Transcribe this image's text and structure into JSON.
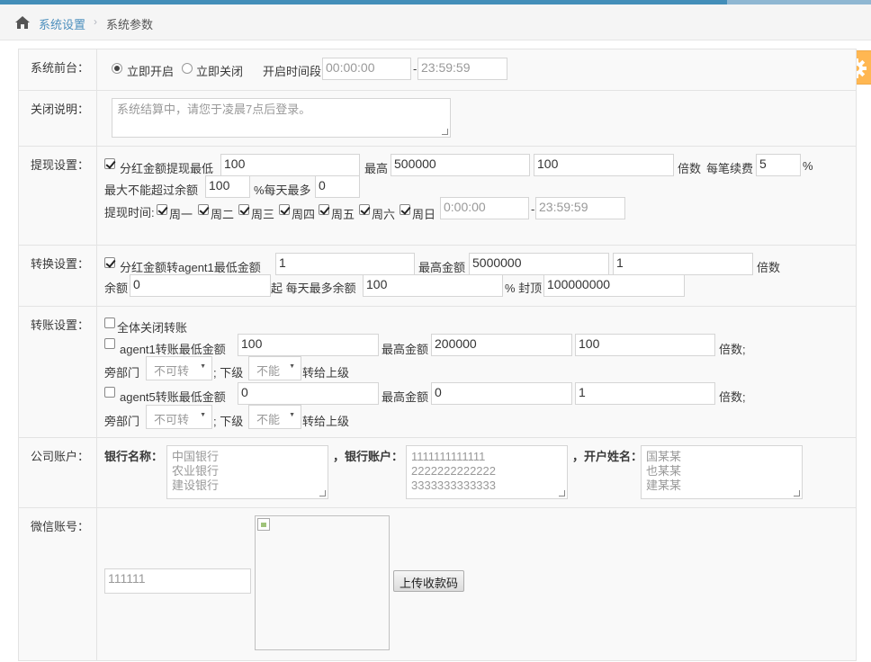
{
  "breadcrumb": {
    "home_icon": "home-icon",
    "items": [
      "系统设置",
      "系统参数"
    ]
  },
  "settings_icon": "gear-icon",
  "front": {
    "label": "系统前台：",
    "open_label": "立即开启",
    "close_label": "立即关闭",
    "open_checked": true,
    "period_label": "开启时间段",
    "start_time": "00:00:00",
    "dash": "-",
    "end_time": "23:59:59"
  },
  "close_desc": {
    "label": "关闭说明：",
    "placeholder": "系统结算中，请您于凌晨7点后登录。"
  },
  "withdraw": {
    "label": "提现设置：",
    "checkbox_label": "分红金额提现最低",
    "min": "100",
    "max_label": "最高",
    "max": "500000",
    "multiple": "100",
    "multiple_label": "倍数",
    "fee_label": "每笔续费",
    "fee": "5",
    "percent": "%",
    "max_balance_label": "最大不能超过余额",
    "max_balance": "100",
    "daily_label": "%每天最多",
    "daily": "0",
    "time_label": "提现时间:",
    "days": [
      "周一",
      "周二",
      "周三",
      "周四",
      "周五",
      "周六",
      "周日"
    ],
    "start_time": "0:00:00",
    "dash": "-",
    "end_time": "23:59:59"
  },
  "convert": {
    "label": "转换设置：",
    "checkbox_label": "分红金额转agent1最低金额",
    "min": "1",
    "max_label": "最高金额",
    "max": "5000000",
    "multiple": "1",
    "multiple_label": "倍数",
    "balance_label": "余额",
    "balance": "0",
    "daily_label": "起 每天最多余额",
    "daily": "100",
    "cap_label": "% 封顶",
    "cap": "100000000"
  },
  "transfer": {
    "label": "转账设置：",
    "close_all_label": "全体关闭转账",
    "agent1": {
      "label": "agent1转账最低金额",
      "min": "100",
      "max_label": "最高金额",
      "max": "200000",
      "multiple": "100",
      "multiple_label": "倍数;"
    },
    "agent5": {
      "label": "agent5转账最低金额",
      "min": "0",
      "max_label": "最高金额",
      "max": "0",
      "multiple": "1",
      "multiple_label": "倍数;"
    },
    "dept_label": "旁部门",
    "dept_value": "不可转",
    "sub_label": "; 下级",
    "sub_value": "不能",
    "to_parent_label": "转给上级"
  },
  "company": {
    "label": "公司账户：",
    "bank_name_label": "银行名称：",
    "bank_names": "中国银行\n农业银行\n建设银行",
    "account_label": "，银行账户：",
    "accounts": "1111111111111\n2222222222222\n3333333333333",
    "holder_label": "，开户姓名：",
    "holders": "国某某\n也某某\n建某某"
  },
  "wechat": {
    "label": "微信账号：",
    "account_placeholder": "111111",
    "upload_label": "上传收款码"
  }
}
